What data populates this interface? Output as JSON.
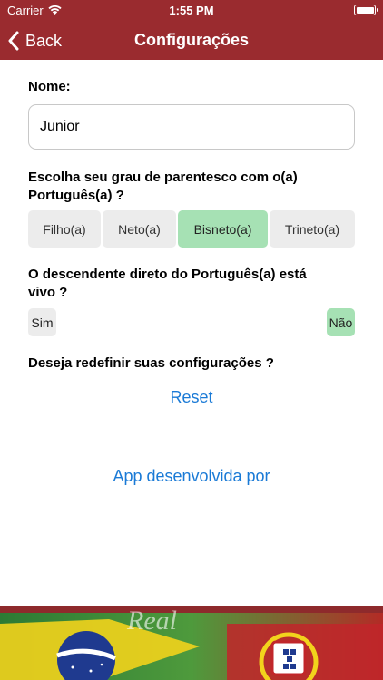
{
  "status_bar": {
    "carrier": "Carrier",
    "time": "1:55 PM",
    "icons": [
      "wifi-icon",
      "battery-icon"
    ]
  },
  "nav": {
    "back_label": "Back",
    "title": "Configurações",
    "bar_color": "#9a2b2f"
  },
  "form": {
    "name_label": "Nome:",
    "name_value": "Junior",
    "relationship_label_line1": "Escolha seu grau de parentesco com o(a)",
    "relationship_label_line2": "Português(a) ?",
    "relationship_options": [
      "Filho(a)",
      "Neto(a)",
      "Bisneto(a)",
      "Trineto(a)"
    ],
    "relationship_selected": "Bisneto(a)",
    "alive_label_line1": "O descendente direto do Português(a) está",
    "alive_label_line2": "vivo ?",
    "alive_options": [
      "Sim",
      "Não"
    ],
    "alive_selected": "Não",
    "reset_question": "Deseja redefinir suas configurações ?",
    "reset_label": "Reset",
    "credits_label": "App desenvolvida por"
  },
  "colors": {
    "selected": "#a6e1b4",
    "unselected": "#ececec",
    "link": "#1a7ad6"
  },
  "banner": {
    "text": "Real"
  }
}
